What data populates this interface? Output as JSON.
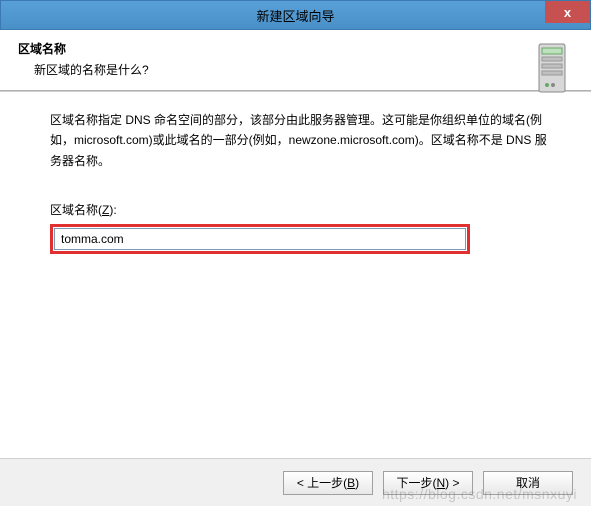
{
  "titlebar": {
    "title": "新建区域向导",
    "close": "x"
  },
  "header": {
    "title": "区域名称",
    "subtitle": "新区域的名称是什么?"
  },
  "content": {
    "description": "区域名称指定 DNS 命名空间的部分，该部分由此服务器管理。这可能是你组织单位的域名(例如，microsoft.com)或此域名的一部分(例如，newzone.microsoft.com)。区域名称不是 DNS 服务器名称。",
    "field_label_prefix": "区域名称(",
    "field_label_key": "Z",
    "field_label_suffix": "):",
    "field_value": "tomma.com"
  },
  "buttons": {
    "back_prefix": "< 上一步(",
    "back_key": "B",
    "back_suffix": ")",
    "next_prefix": "下一步(",
    "next_key": "N",
    "next_suffix": ") >",
    "cancel": "取消"
  },
  "watermark": "https://blog.csdn.net/msnxuyi"
}
